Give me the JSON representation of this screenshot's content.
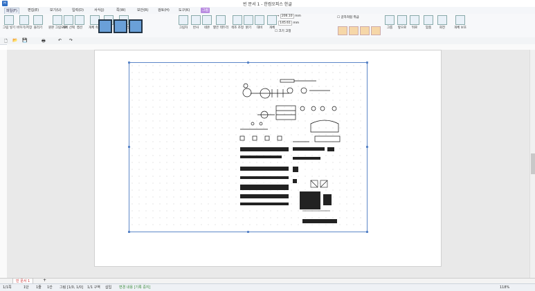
{
  "window": {
    "title": "빈 문서 1 - 한컴오피스 한글"
  },
  "menu": [
    {
      "label": "파일(F)",
      "kind": "file"
    },
    {
      "label": "편집(E)",
      "kind": "normal"
    },
    {
      "label": "보기(U)",
      "kind": "normal"
    },
    {
      "label": "입력(D)",
      "kind": "normal"
    },
    {
      "label": "서식(J)",
      "kind": "normal"
    },
    {
      "label": "쪽(W)",
      "kind": "normal"
    },
    {
      "label": "보안(R)",
      "kind": "normal"
    },
    {
      "label": "검토(H)",
      "kind": "normal"
    },
    {
      "label": "도구(K)",
      "kind": "normal"
    },
    {
      "label": "그림",
      "kind": "active"
    }
  ],
  "ribbon": {
    "tools": [
      "그림 넣기",
      "바꾸기/저장",
      "올리기",
      "원본 그림으로",
      "개체 선택",
      "캡션",
      "개체 속성",
      "선 색",
      "선 스타일",
      "그림자",
      "반사",
      "네온",
      "옅은 테두리",
      "색조 조정",
      "밝기",
      "대비",
      "개체",
      "가로",
      "세로",
      "그룹",
      "앞으로",
      "뒤로",
      "맞춤",
      "회전",
      "개체 보호"
    ],
    "width_value": "206.10",
    "height_value": "145.61",
    "unit": "mm",
    "size_lock_label": "크기 고정",
    "aspect_label": "글자처럼 취급"
  },
  "statusbar": {
    "page": "1/1쪽",
    "section": "1단",
    "line": "1줄",
    "col": "1칸",
    "pic": "그림 [1/0, 1/0]",
    "zone": "1/1 구역",
    "insert": "삽입",
    "track": "변경 내용 [기록 중지]",
    "zoom": "118%"
  },
  "tabs": {
    "doc": "빈 문서 1"
  },
  "ui_colors": {
    "accent": "#b88be0",
    "selection": "#5b86c8"
  }
}
